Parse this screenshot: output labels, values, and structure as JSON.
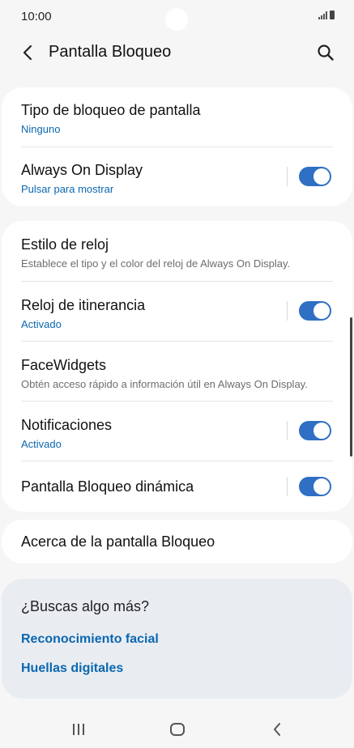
{
  "status": {
    "time": "10:00"
  },
  "header": {
    "title": "Pantalla Bloqueo"
  },
  "card1": {
    "lock_type": {
      "title": "Tipo de bloqueo de pantalla",
      "sub": "Ninguno"
    },
    "aod": {
      "title": "Always On Display",
      "sub": "Pulsar para mostrar"
    }
  },
  "card2": {
    "clock_style": {
      "title": "Estilo de reloj",
      "sub": "Establece el tipo y el color del reloj de Always On Display."
    },
    "roaming_clock": {
      "title": "Reloj de itinerancia",
      "sub": "Activado"
    },
    "facewidgets": {
      "title": "FaceWidgets",
      "sub": "Obtén acceso rápido a información útil en Always On Display."
    },
    "notifications": {
      "title": "Notificaciones",
      "sub": "Activado"
    },
    "dynamic_lock": {
      "title": "Pantalla Bloqueo dinámica"
    }
  },
  "card3": {
    "about": {
      "title": "Acerca de la pantalla Bloqueo"
    }
  },
  "more": {
    "title": "¿Buscas algo más?",
    "link1": "Reconocimiento facial",
    "link2": "Huellas digitales"
  },
  "toggles": {
    "aod": true,
    "roaming_clock": true,
    "notifications": true,
    "dynamic_lock": true
  },
  "colors": {
    "accent": "#2f6fc4",
    "link": "#0b67b0",
    "background": "#f6f6f6",
    "more_bg": "#e9edf2"
  },
  "icons": {
    "back": "chevron-left-icon",
    "search": "search-icon",
    "recents": "recents-icon",
    "home": "home-icon",
    "nav_back": "back-icon"
  }
}
